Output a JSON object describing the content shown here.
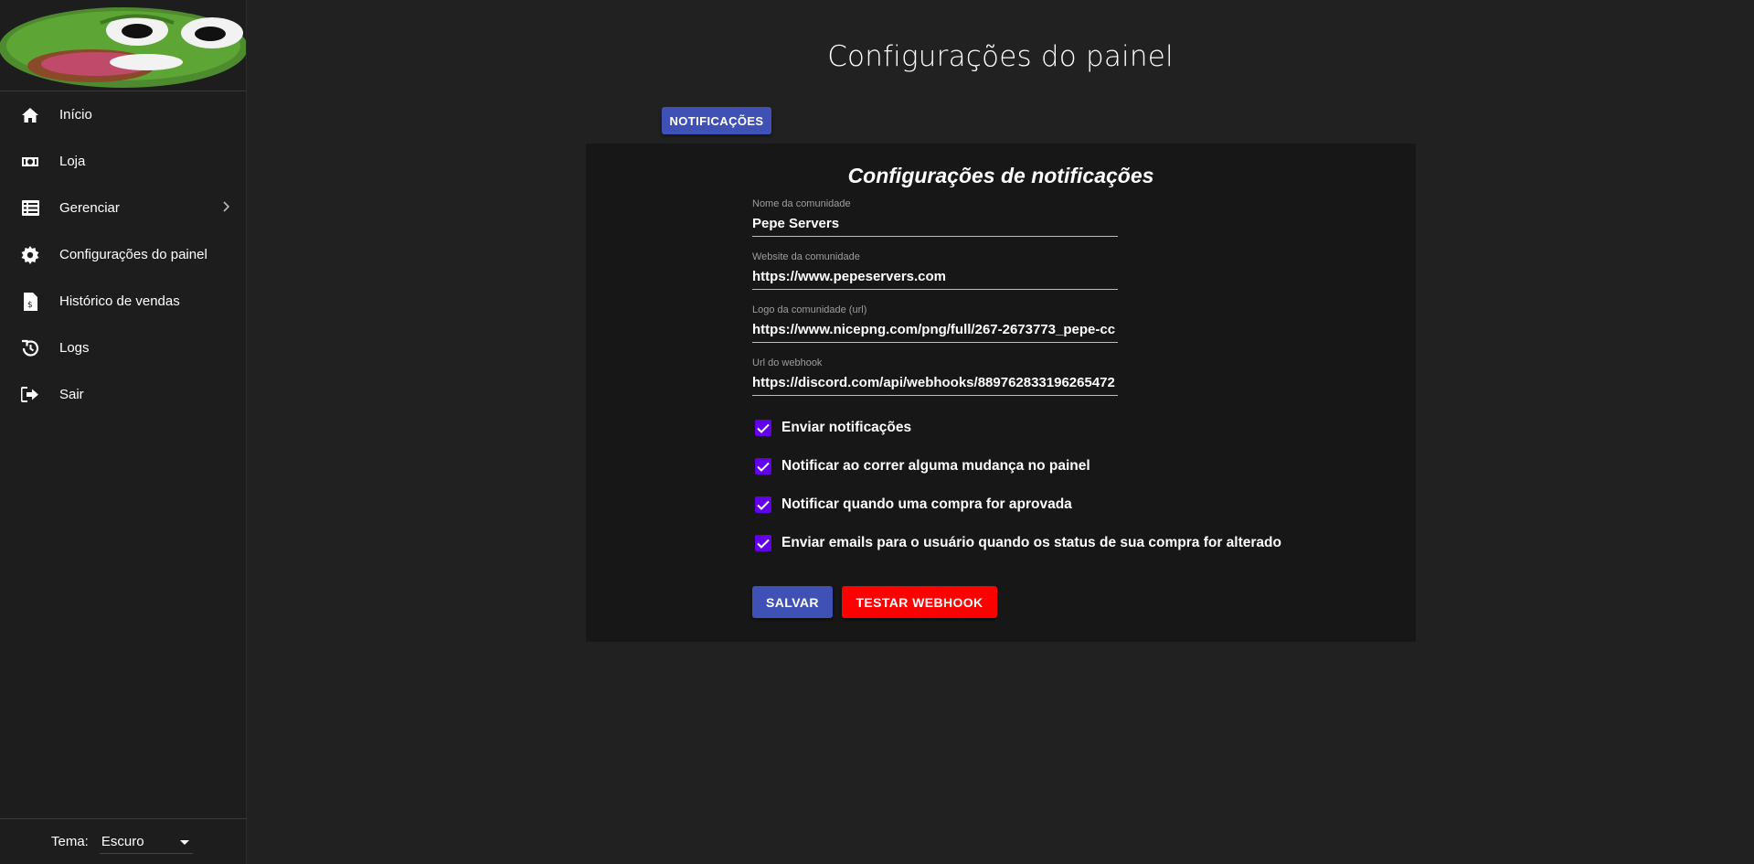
{
  "sidebar": {
    "items": [
      {
        "label": "Início",
        "icon": "home-icon"
      },
      {
        "label": "Loja",
        "icon": "money-icon"
      },
      {
        "label": "Gerenciar",
        "icon": "list-icon"
      },
      {
        "label": "Configurações do painel",
        "icon": "gear-icon"
      },
      {
        "label": "Histórico de vendas",
        "icon": "invoice-icon"
      },
      {
        "label": "Logs",
        "icon": "history-icon"
      },
      {
        "label": "Sair",
        "icon": "logout-icon"
      }
    ],
    "theme": {
      "label": "Tema:",
      "value": "Escuro"
    }
  },
  "main": {
    "title": "Configurações do painel",
    "tab_label": "NOTIFICAÇÕES",
    "card": {
      "title": "Configurações de notificações",
      "fields": [
        {
          "label": "Nome da comunidade",
          "value": "Pepe Servers"
        },
        {
          "label": "Website da comunidade",
          "value": "https://www.pepeservers.com"
        },
        {
          "label": "Logo da comunidade (url)",
          "value": "https://www.nicepng.com/png/full/267-2673773_pepe-cc"
        },
        {
          "label": "Url do webhook",
          "value": "https://discord.com/api/webhooks/889762833196265472"
        }
      ],
      "checkboxes": [
        {
          "label": "Enviar notificações",
          "checked": true
        },
        {
          "label": "Notificar ao correr alguma mudança no painel",
          "checked": true
        },
        {
          "label": "Notificar quando uma compra for aprovada",
          "checked": true
        },
        {
          "label": "Enviar emails para o usuário quando os status de sua compra for alterado",
          "checked": true
        }
      ],
      "save_label": "SALVAR",
      "test_label": "TESTAR WEBHOOK"
    }
  },
  "colors": {
    "accent": "#3f51b5",
    "danger": "#ff0000",
    "checkbox": "#6200ea",
    "background": "#212121"
  }
}
